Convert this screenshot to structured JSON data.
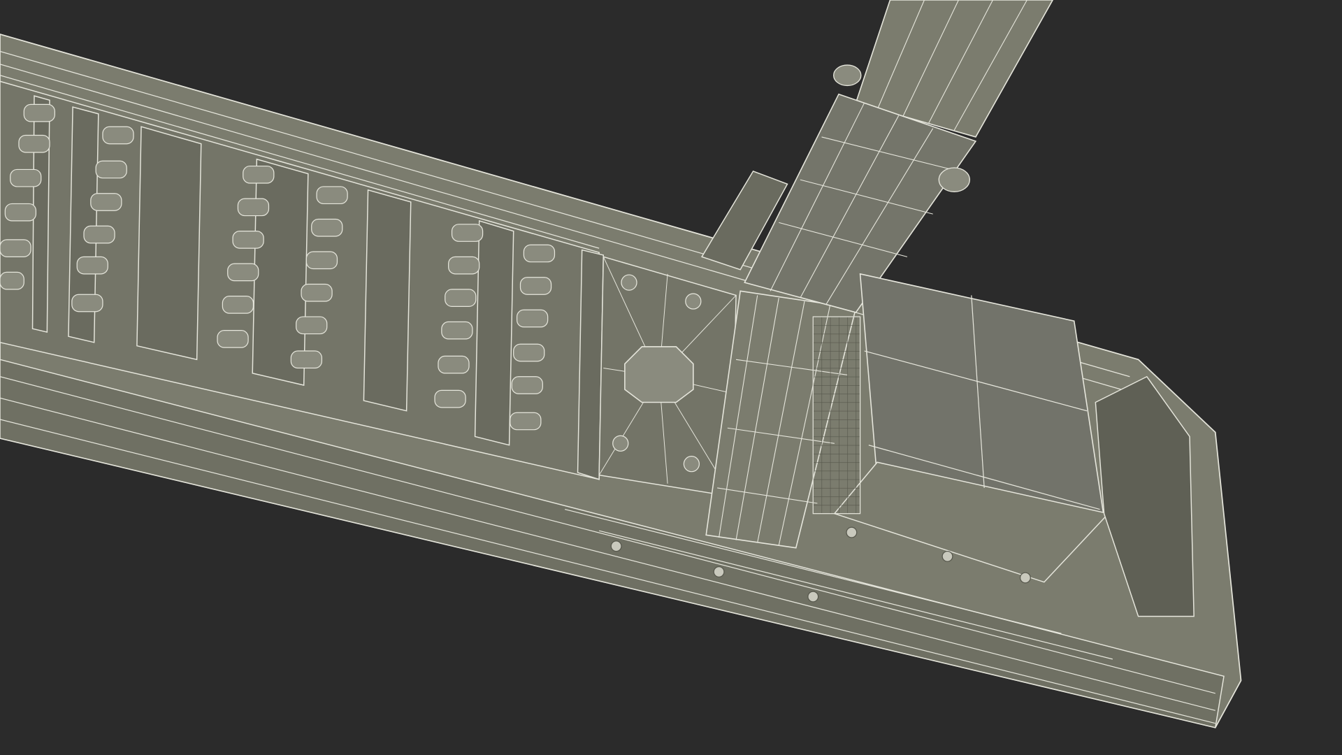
{
  "scene": {
    "subject": "wireframe-3d-model",
    "background_color": "#2b2b2b",
    "surface_color": "#7b7c6e",
    "surface_shade_color": "#6a6b5f",
    "surface_dark_color": "#55564b",
    "wire_color": "#e6e6dc",
    "bolt_color": "#c9c9bd"
  }
}
